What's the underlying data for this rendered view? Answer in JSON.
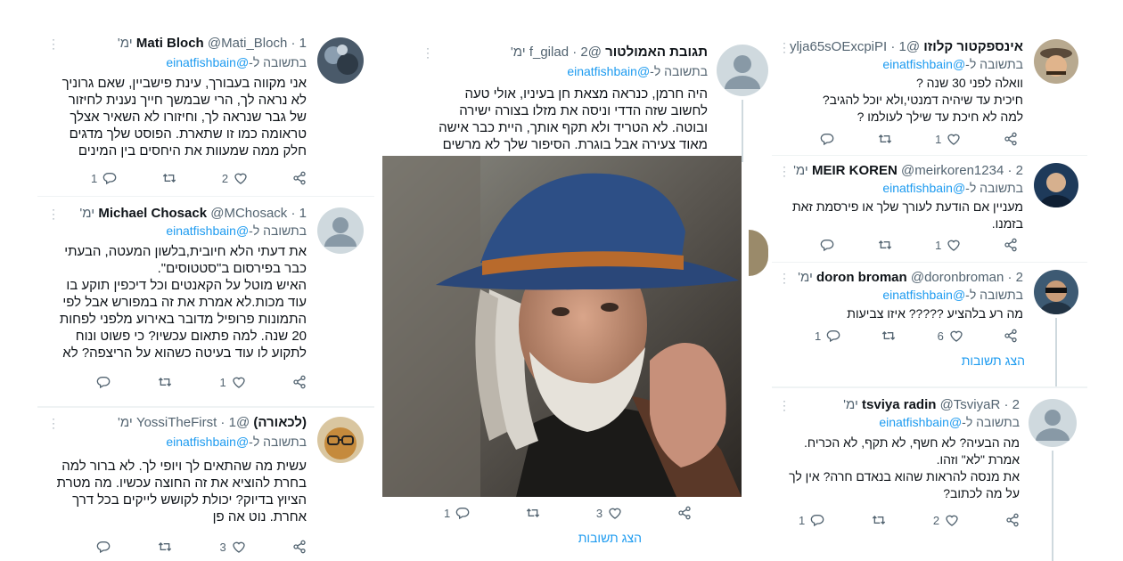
{
  "reply_prefix": "בתשובה ל-",
  "mention": "@einatfishbain",
  "left_column": {
    "tweets": [
      {
        "name": "Mati Bloch",
        "handle": "@Mati_Bloch",
        "time": "1 ימ'",
        "body": "אני מקווה בעבורך, עינת פישביין, שאם גרוניך לא נראה לך, הרי שבמשך חייך נענית לחיזור של גבר שנראה לך, וחיזורו לא השאיר אצלך טראומה כמו זו שתארת. הפוסט שלך מדגים חלק ממה שמעוות את היחסים בין המינים ב\"מי טו\".",
        "likes": "2",
        "replies": "1"
      },
      {
        "name": "Michael Chosack",
        "handle": "@MChosack",
        "time": "1 ימ'",
        "body": "את דעתי הלא חיובית,בלשון המעטה, הבעתי כבר בפירסום ב\"סטטוסים\".\nהאיש מוטל על הקאנטים וכל דיכפין תוקע בו עוד מכות.לא אמרת את זה במפורש אבל לפי התמונות פרופיל מדובר באירוע מלפני לפחות 20 שנה. למה פתאום עכשיו? כי פשוט ונוח לתקוע לו עוד בעיטה כשהוא על הריצפה? לא גבורה גדולה. לא עוז נפש",
        "likes": "1",
        "replies": ""
      },
      {
        "name": "(לכאורה)",
        "handle": "@YossiTheFirst",
        "time": "1 ימ'",
        "body": "עשית מה שהתאים לך ויופי לך. לא ברור למה בחרת להוציא את זה החוצה עכשיו. מה מטרת הציוץ בדיוק? יכולת לקושש לייקים בכל דרך אחרת. נוט אה פן",
        "likes": "3",
        "replies": ""
      }
    ]
  },
  "middle_column": {
    "tweet": {
      "name": "תגובת האמולטור",
      "handle": "@f_gilad",
      "time": "2 ימ'",
      "body": "היה חרמן, כנראה מצאת חן בעיניו, אולי טעה לחשוב שזה הדדי וניסה את מזלו בצורה ישירה ובוטה. לא הטריד ולא תקף אותך, היית כבר אישה מאוד צעירה אבל בוגרת. הסיפור שלך לא מרשים ולא"
    },
    "bottom_actions": {
      "likes": "3",
      "replies": "1"
    },
    "show_replies": "הצג תשובות"
  },
  "right_column": {
    "tweets": [
      {
        "name": "אינספקטור קלוזו",
        "handle": "@ylja65sOExcpiPI",
        "time": "1 ימ'",
        "body": "וואלה לפני 30 שנה ?\nחיכית עד שיהיה דמנטי,ולא יוכל להגיב?\nלמה לא חיכת עד שילך לעולמו ?",
        "likes": "1",
        "replies": ""
      },
      {
        "name": "MEIR KOREN",
        "handle": "@meirkoren1234",
        "time": "2 ימ'",
        "body": "מעניין אם הודעת לעורך שלך או פירסמת זאת בזמנו.",
        "likes": "1",
        "replies": ""
      },
      {
        "name": "doron broman",
        "handle": "@doronbroman",
        "time": "2 ימ'",
        "body": "מה רע בלהציע ????? איזו צביעות",
        "likes": "6",
        "replies": "1"
      },
      {
        "name": "tsviya radin",
        "handle": "@TsviyaR",
        "time": "2 ימ'",
        "body": "מה הבעיה? לא חשף, לא תקף, לא הכריח. אמרת \"לא\" וזהו.\nאת מנסה להראות שהוא בנאדם חרה? אין לך על מה לכתוב?",
        "likes": "2",
        "replies": "1"
      }
    ],
    "show_replies": "הצג תשובות"
  },
  "colors": {
    "text": "#0f1419",
    "secondary": "#536471",
    "link": "#1d9bf0",
    "border": "#eff3f4"
  },
  "icons": [
    "share-icon",
    "heart-icon",
    "retweet-icon",
    "reply-icon",
    "more-icon"
  ]
}
